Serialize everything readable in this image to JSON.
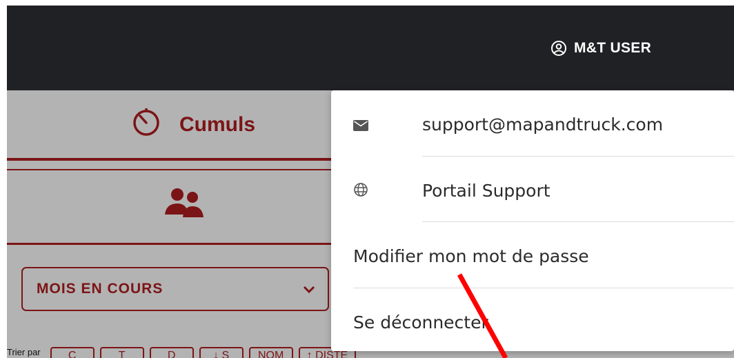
{
  "header": {
    "user_label": "M&T USER"
  },
  "background": {
    "cumuls_label": "Cumuls",
    "period_select_value": "MOIS EN COURS",
    "sort_label": "Trier par",
    "sort_buttons": [
      "C",
      "T",
      "D",
      "↓ S",
      "NOM",
      "↑ DISTE"
    ]
  },
  "user_menu": {
    "items": [
      {
        "label": "support@mapandtruck.com",
        "icon": "envelope-icon"
      },
      {
        "label": "Portail Support",
        "icon": "globe-icon"
      },
      {
        "label": "Modifier mon mot de passe"
      },
      {
        "label": "Se déconnecter"
      }
    ]
  },
  "colors": {
    "topbar": "#202124",
    "accent": "#7b1416",
    "overlay_bg": "#b3b3b3",
    "menu_bg": "#ffffff",
    "annotation_arrow": "#ff0000"
  }
}
